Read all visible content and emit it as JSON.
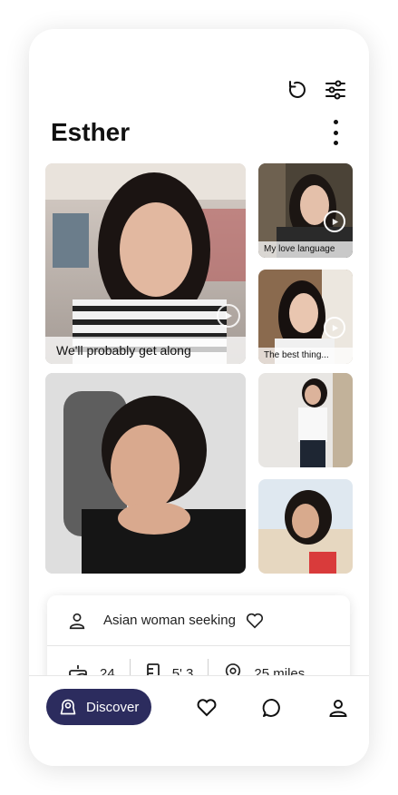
{
  "profile": {
    "name": "Esther",
    "seeking": "Asian woman seeking",
    "age": "24",
    "height": "5' 3",
    "distance": "25 miles"
  },
  "media": [
    {
      "caption": "We'll probably get along",
      "type": "video"
    },
    {
      "caption": "My love language",
      "type": "video"
    },
    {
      "caption": "The best thing...",
      "type": "video"
    },
    {
      "caption": "",
      "type": "photo"
    },
    {
      "caption": "",
      "type": "photo"
    },
    {
      "caption": "",
      "type": "photo"
    }
  ],
  "nav": {
    "discover_label": "Discover",
    "items": [
      "discover",
      "likes",
      "messages",
      "profile"
    ]
  },
  "icons": [
    "refresh-icon",
    "filter-sliders-icon",
    "more-vertical-icon",
    "play-icon",
    "user-icon",
    "heart-icon",
    "cake-icon",
    "ruler-icon",
    "location-pin-icon",
    "chat-bubble-icon"
  ],
  "colors": {
    "accent": "#2c2c5e",
    "text": "#111111",
    "background": "#ffffff"
  }
}
